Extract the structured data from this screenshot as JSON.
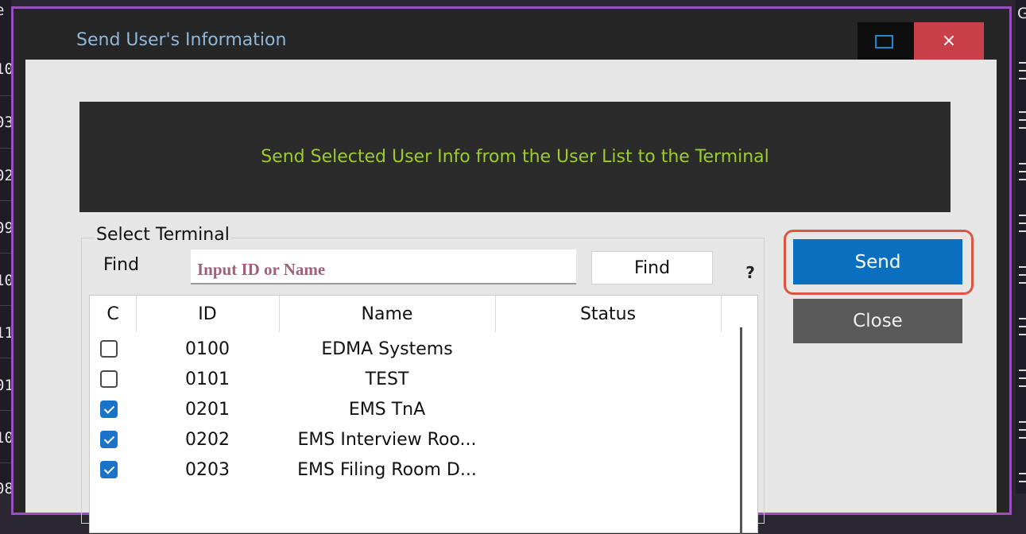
{
  "background": {
    "left_fragments": [
      "e",
      "10",
      "03",
      "02",
      "09",
      "10",
      "11",
      "01",
      "10",
      "08"
    ],
    "right_fragment": "G"
  },
  "window": {
    "title": "Send User's Information",
    "close_glyph": "×",
    "maximize_icon": "maximize-icon",
    "border_color": "#9b50c0"
  },
  "banner": {
    "text": "Send Selected User Info from the User List to the Terminal",
    "text_color": "#9ccc2c"
  },
  "terminal_group": {
    "label": "Select Terminal",
    "find_label": "Find",
    "search_placeholder": "Input ID or Name",
    "search_value": "",
    "find_button": "Find",
    "help_glyph": "?"
  },
  "table": {
    "columns": [
      "C",
      "ID",
      "Name",
      "Status"
    ],
    "rows": [
      {
        "checked": false,
        "id": "0100",
        "name": "EDMA Systems",
        "status": ""
      },
      {
        "checked": false,
        "id": "0101",
        "name": "TEST",
        "status": ""
      },
      {
        "checked": true,
        "id": "0201",
        "name": "EMS TnA",
        "status": ""
      },
      {
        "checked": true,
        "id": "0202",
        "name": "EMS Interview Roo...",
        "status": ""
      },
      {
        "checked": true,
        "id": "0203",
        "name": "EMS Filing Room D...",
        "status": ""
      }
    ]
  },
  "actions": {
    "send": "Send",
    "close": "Close",
    "send_color": "#0a6fbf",
    "highlight_color": "#d9573f"
  }
}
